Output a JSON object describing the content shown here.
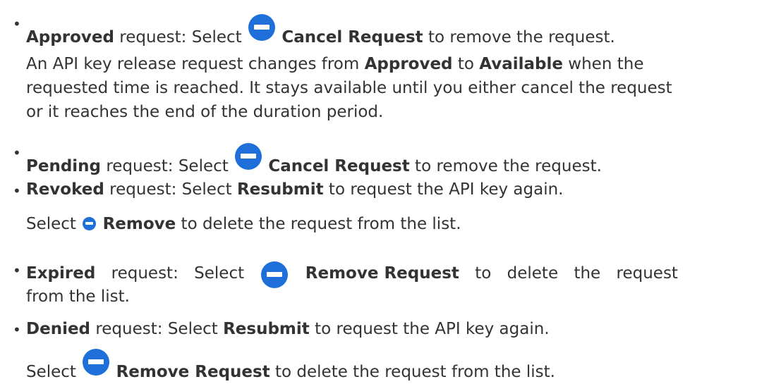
{
  "items": [
    {
      "status": "Approved",
      "text1": " request: Select ",
      "action": "Cancel Request",
      "text2": " to remove the request.",
      "note": {
        "l1_a": "An API key release request changes from ",
        "l1_b1": "Approved",
        "l1_c": " to ",
        "l1_b2": "Available",
        "l1_d": " when the",
        "l2": "requested time is reached. It stays available until you either cancel the request",
        "l3": "or it reaches the end of the duration period."
      }
    },
    {
      "status": "Pending",
      "text1": " request: Select ",
      "action": "Cancel Request",
      "text2": " to remove the request."
    },
    {
      "status": "Revoked",
      "text1": " request: Select ",
      "action": "Resubmit",
      "text2": " to request the API key again.",
      "note": {
        "a": "Select ",
        "action": "Remove",
        "b": " to delete the request from the list."
      }
    },
    {
      "status": "Expired",
      "w1": "request:",
      "w2": "Select",
      "action": "Remove Request",
      "w3": "to",
      "w4": "delete",
      "w5": "the",
      "w6": "request",
      "cont": "from the list."
    },
    {
      "status": "Denied",
      "text1": " request: Select ",
      "action": "Resubmit",
      "text2": " to request the API key again.",
      "note": {
        "a": "Select ",
        "action": "Remove Request",
        "b": " to delete the request from the list."
      }
    }
  ]
}
